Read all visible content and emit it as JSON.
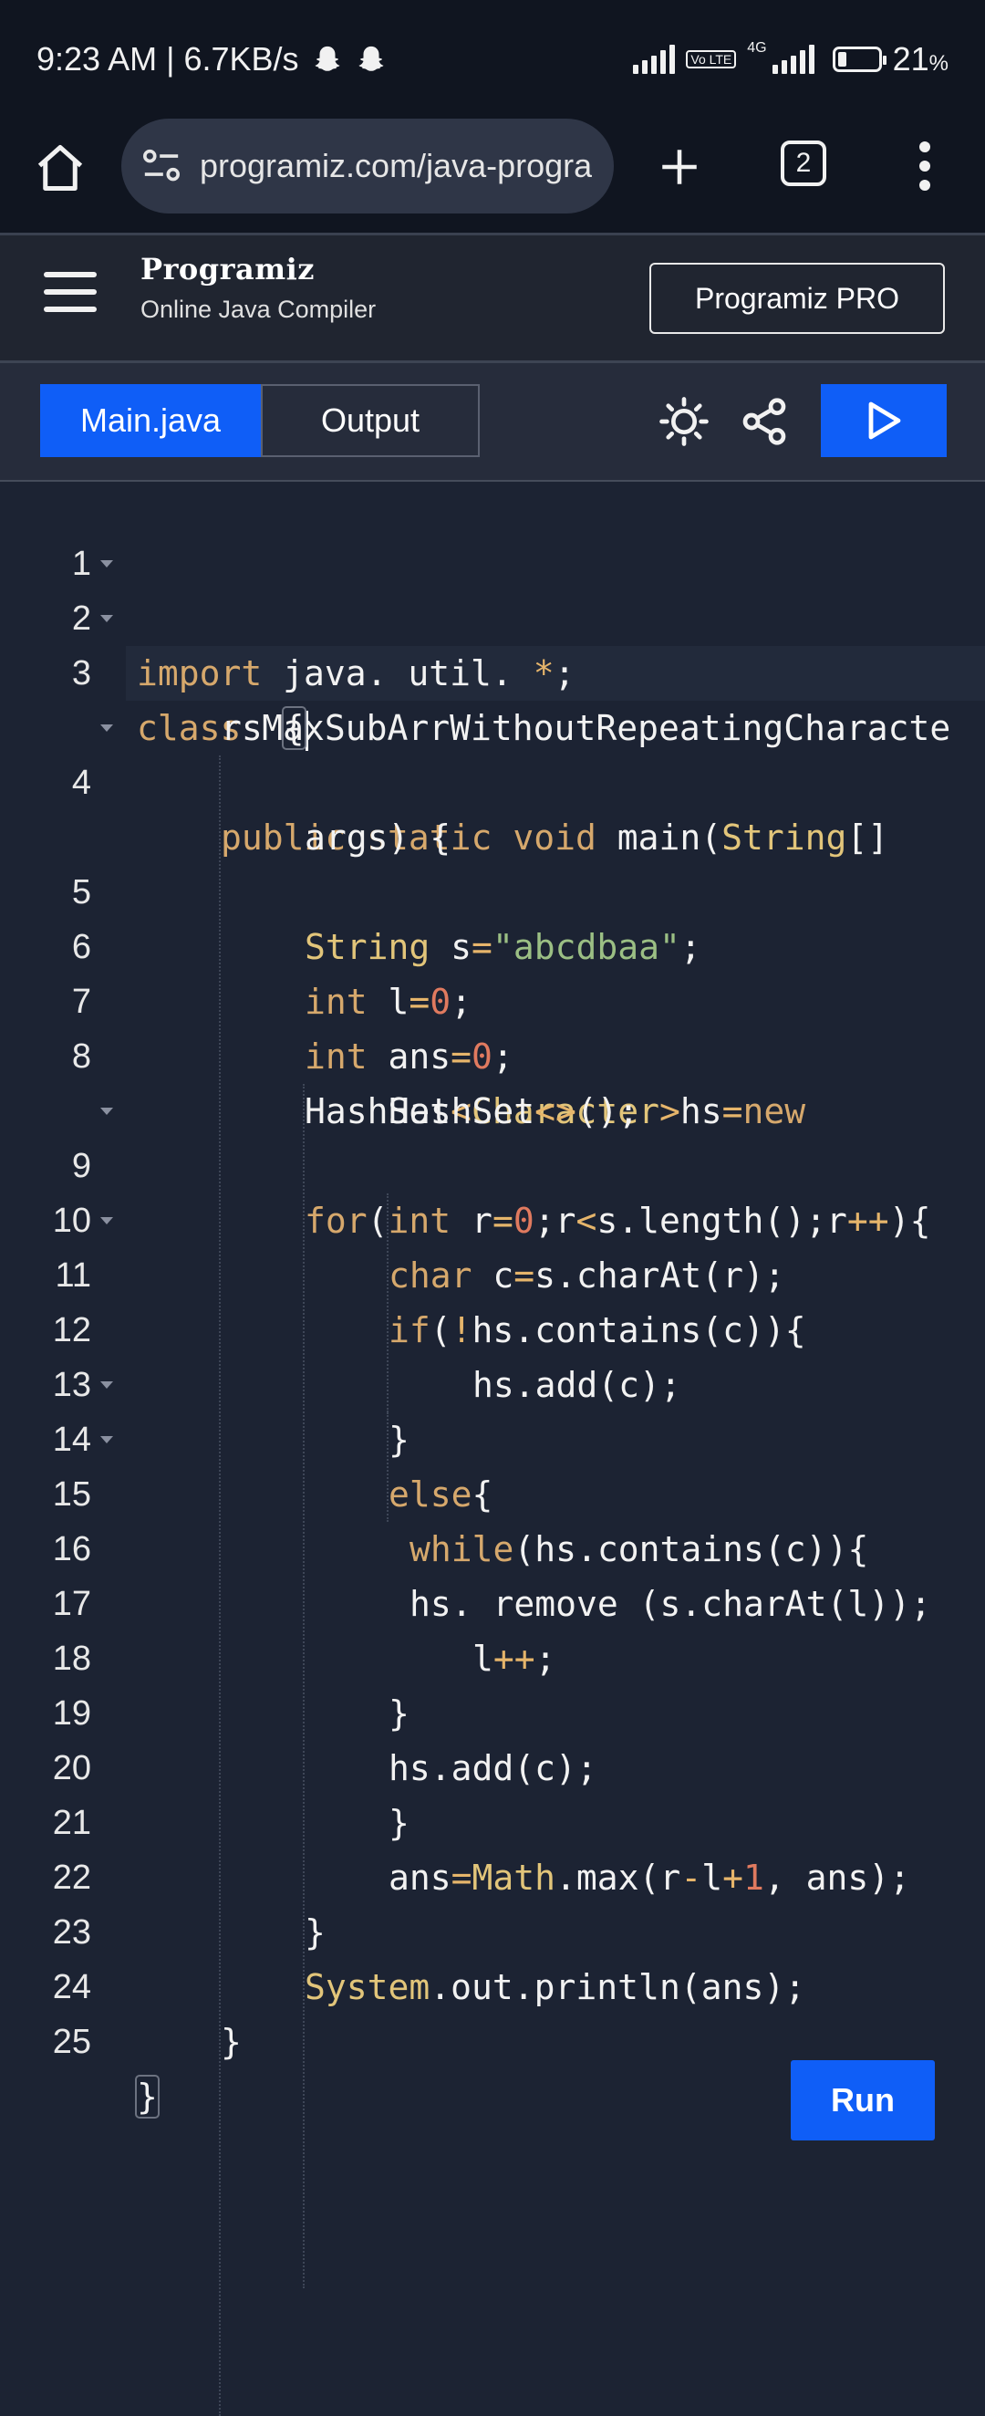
{
  "status_bar": {
    "time_speed": "9:23 AM | 6.7KB/s",
    "network": "4G",
    "volte": "Vo LTE",
    "battery_percent": "21",
    "battery_unit": "%"
  },
  "browser": {
    "url": "programiz.com/java-progra",
    "tab_count": "2"
  },
  "site": {
    "logo": "Programiz",
    "subtitle": "Online Java Compiler",
    "pro_button": "Programiz PRO"
  },
  "toolbar": {
    "file_tab": "Main.java",
    "output_tab": "Output"
  },
  "editor": {
    "line_numbers": [
      "1",
      "2",
      "3",
      "4",
      "5",
      "6",
      "7",
      "8",
      "9",
      "10",
      "11",
      "12",
      "13",
      "14",
      "15",
      "16",
      "17",
      "18",
      "19",
      "20",
      "21",
      "22",
      "23",
      "24",
      "25"
    ]
  },
  "run_button": "Run",
  "icons": {
    "home": "home-icon",
    "site_settings": "tune-icon",
    "new_tab": "plus-icon",
    "tabs": "tabs-icon",
    "menu": "more-vert-icon",
    "hamburger": "hamburger-menu-icon",
    "theme": "sun-icon",
    "share": "share-icon",
    "run": "play-icon"
  },
  "colors": {
    "accent": "#0f5ef7",
    "background": "#1c2333",
    "keyword": "#d6a86c",
    "string": "#9bbf84",
    "number": "#e07a5f"
  }
}
